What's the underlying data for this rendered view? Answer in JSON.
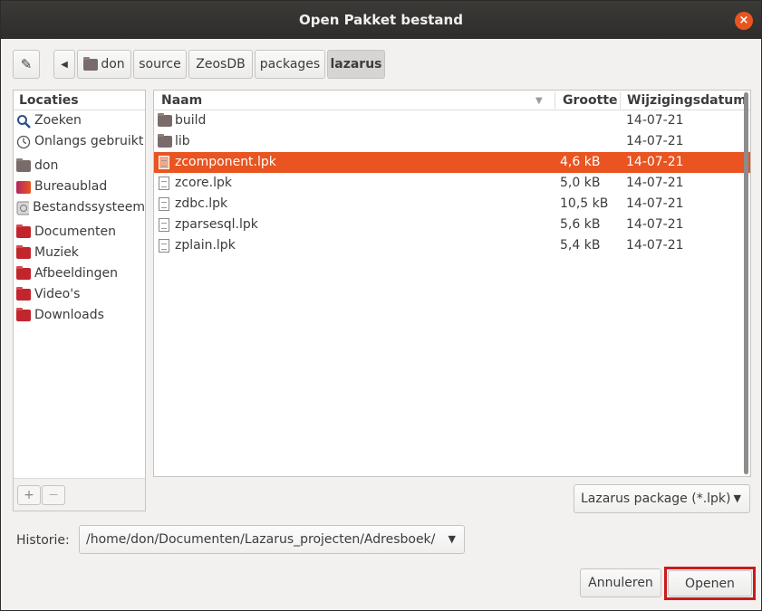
{
  "window": {
    "title": "Open Pakket bestand",
    "close_icon": "×"
  },
  "toolbar": {
    "edit_icon": "✎",
    "back_icon": "◀"
  },
  "breadcrumb": [
    "don",
    "source",
    "ZeosDB",
    "packages",
    "lazarus"
  ],
  "places": {
    "header": "Locaties",
    "items": [
      {
        "label": "Zoeken",
        "icon": "search-icon"
      },
      {
        "label": "Onlangs gebruikt",
        "icon": "recent-icon"
      },
      {
        "label": "don",
        "icon": "home-folder-icon"
      },
      {
        "label": "Bureaublad",
        "icon": "desktop-icon"
      },
      {
        "label": "Bestandssysteem",
        "icon": "drive-icon"
      },
      {
        "label": "Documenten",
        "icon": "folder-icon"
      },
      {
        "label": "Muziek",
        "icon": "folder-icon"
      },
      {
        "label": "Afbeeldingen",
        "icon": "folder-icon"
      },
      {
        "label": "Video's",
        "icon": "folder-icon"
      },
      {
        "label": "Downloads",
        "icon": "folder-icon"
      }
    ],
    "add_label": "+",
    "remove_label": "—"
  },
  "files": {
    "columns": {
      "name": "Naam",
      "size": "Grootte",
      "modified": "Wijzigingsdatum"
    },
    "rows": [
      {
        "name": "build",
        "size": "",
        "modified": "14-07-21",
        "type": "folder"
      },
      {
        "name": "lib",
        "size": "",
        "modified": "14-07-21",
        "type": "folder"
      },
      {
        "name": "zcomponent.lpk",
        "size": "4,6 kB",
        "modified": "14-07-21",
        "type": "file",
        "selected": true
      },
      {
        "name": "zcore.lpk",
        "size": "5,0 kB",
        "modified": "14-07-21",
        "type": "file"
      },
      {
        "name": "zdbc.lpk",
        "size": "10,5 kB",
        "modified": "14-07-21",
        "type": "file"
      },
      {
        "name": "zparsesql.lpk",
        "size": "5,6 kB",
        "modified": "14-07-21",
        "type": "file"
      },
      {
        "name": "zplain.lpk",
        "size": "5,4 kB",
        "modified": "14-07-21",
        "type": "file"
      }
    ]
  },
  "filter": {
    "value": "Lazarus package (*.lpk)"
  },
  "history": {
    "label": "Historie:",
    "value": "/home/don/Documenten/Lazarus_projecten/Adresboek/"
  },
  "buttons": {
    "cancel": "Annuleren",
    "open": "Openen"
  },
  "colors": {
    "accent": "#e95420",
    "highlight_border": "#cc1a1a"
  }
}
